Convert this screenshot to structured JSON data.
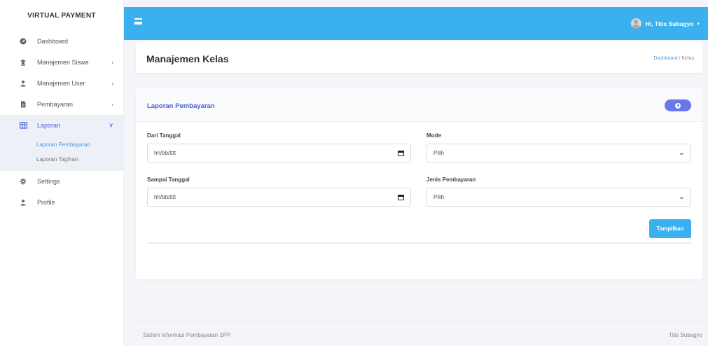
{
  "brand": "VIRTUAL PAYMENT",
  "sidebar": {
    "items": [
      {
        "label": "Dashboard",
        "icon": "dashboard-icon"
      },
      {
        "label": "Manajemen Siswa",
        "icon": "student-icon"
      },
      {
        "label": "Manajemen User",
        "icon": "users-icon"
      },
      {
        "label": "Pembayaran",
        "icon": "file-icon"
      },
      {
        "label": "Laporan",
        "icon": "table-icon"
      },
      {
        "label": "Settings",
        "icon": "gear-icon"
      },
      {
        "label": "Profile",
        "icon": "user-icon"
      }
    ],
    "submenu": [
      {
        "label": "Laporan Pembayaran"
      },
      {
        "label": "Laporan Tagihan"
      }
    ]
  },
  "topbar": {
    "user_greeting": "Hi, Titis Subagyo"
  },
  "header": {
    "title": "Manajemen Kelas",
    "breadcrumb": [
      "Dashboard",
      "/",
      "Kelas"
    ]
  },
  "card": {
    "title": "Laporan Pembayaran",
    "dari_tanggal": {
      "label": "Dari Tanggal",
      "value": "hh/bb/tttt"
    },
    "sampai_tanggal": {
      "label": "Sampai Tanggal",
      "value": "hh/bb/tttt"
    },
    "mode": {
      "label": "Mode",
      "value": "Pilih"
    },
    "jenis_pembayaran": {
      "label": "Jenis Pembayaran",
      "value": "Pilih"
    },
    "submit_label": "Tampilkan"
  },
  "footer": {
    "left": "Sistem Informasi Pembayaran SPP",
    "right": "Titis Subagyo"
  },
  "colors": {
    "topbar": "#3ab0ef",
    "accent": "#4c5fd7",
    "add_button": "#6a77e8"
  }
}
